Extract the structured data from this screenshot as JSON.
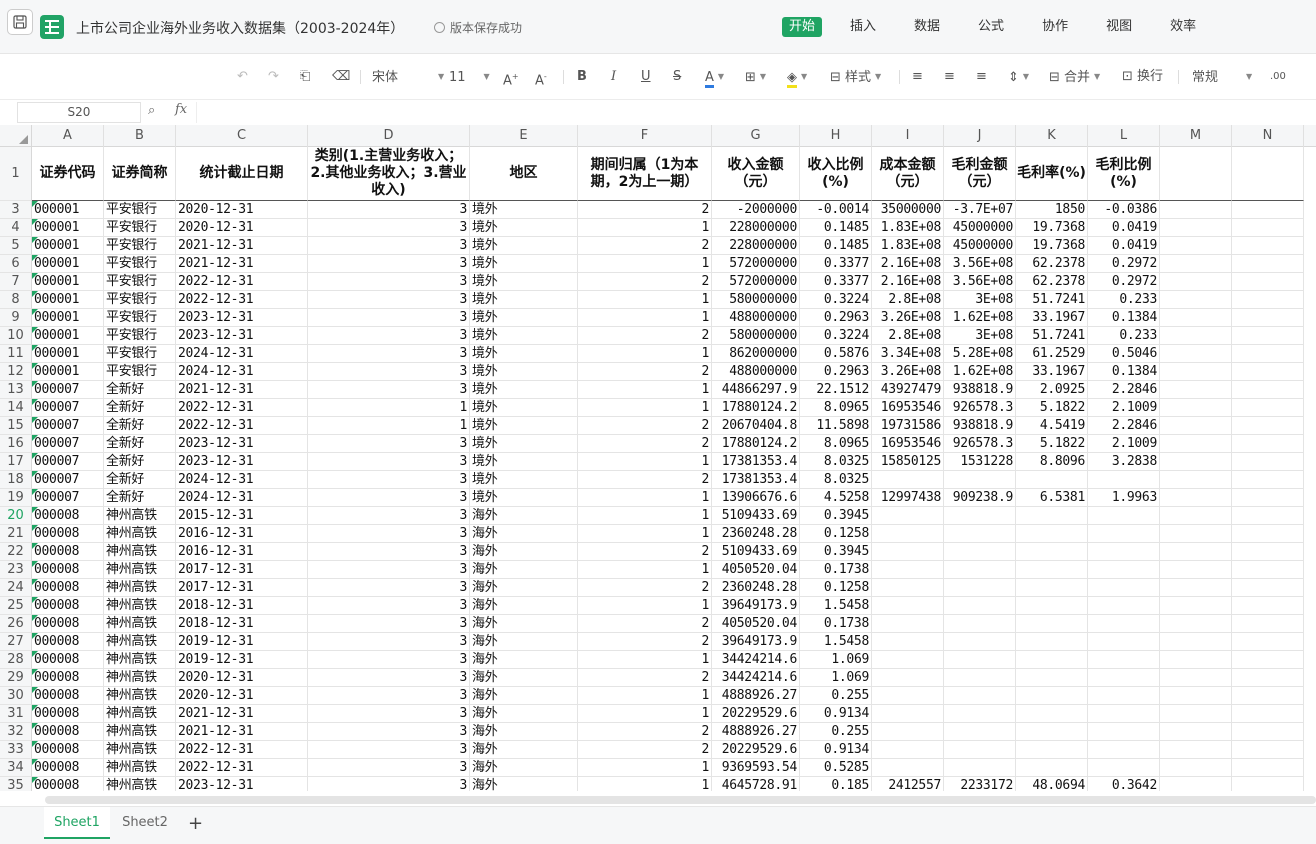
{
  "title_bar": {
    "doc_title": "上市公司企业海外业务收入数据集（2003-2024年）",
    "save_status": "版本保存成功",
    "menu": [
      "开始",
      "插入",
      "数据",
      "公式",
      "协作",
      "视图",
      "效率"
    ],
    "active_menu": "开始"
  },
  "toolbar": {
    "font_name": "宋体",
    "font_size": "11",
    "style_label": "样式",
    "merge_label": "合并",
    "wrap_label": "换行",
    "number_format": "常规"
  },
  "formula_bar": {
    "cell_ref": "S20",
    "fx_label": "fx",
    "value": ""
  },
  "columns": [
    "A",
    "B",
    "C",
    "D",
    "E",
    "F",
    "G",
    "H",
    "I",
    "J",
    "K",
    "L",
    "M",
    "N"
  ],
  "header_row": {
    "row_number": "1",
    "cells": [
      "证券代码",
      "证券简称",
      "统计截止日期",
      "类别(1.主营业务收入；2.其他业务收入；3.营业收入)",
      "地区",
      "期间归属（1为本期，2为上一期）",
      "收入金额（元）",
      "收入比例(%)",
      "成本金额（元）",
      "毛利金额（元）",
      "毛利率(%)",
      "毛利比例(%)"
    ]
  },
  "rows": [
    {
      "n": "3",
      "v": [
        "000001",
        "平安银行",
        "2020-12-31",
        "3",
        "境外",
        "2",
        "-2000000",
        "-0.0014",
        "35000000",
        "-3.7E+07",
        "1850",
        "-0.0386"
      ]
    },
    {
      "n": "4",
      "v": [
        "000001",
        "平安银行",
        "2020-12-31",
        "3",
        "境外",
        "1",
        "228000000",
        "0.1485",
        "1.83E+08",
        "45000000",
        "19.7368",
        "0.0419"
      ]
    },
    {
      "n": "5",
      "v": [
        "000001",
        "平安银行",
        "2021-12-31",
        "3",
        "境外",
        "2",
        "228000000",
        "0.1485",
        "1.83E+08",
        "45000000",
        "19.7368",
        "0.0419"
      ]
    },
    {
      "n": "6",
      "v": [
        "000001",
        "平安银行",
        "2021-12-31",
        "3",
        "境外",
        "1",
        "572000000",
        "0.3377",
        "2.16E+08",
        "3.56E+08",
        "62.2378",
        "0.2972"
      ]
    },
    {
      "n": "7",
      "v": [
        "000001",
        "平安银行",
        "2022-12-31",
        "3",
        "境外",
        "2",
        "572000000",
        "0.3377",
        "2.16E+08",
        "3.56E+08",
        "62.2378",
        "0.2972"
      ]
    },
    {
      "n": "8",
      "v": [
        "000001",
        "平安银行",
        "2022-12-31",
        "3",
        "境外",
        "1",
        "580000000",
        "0.3224",
        "2.8E+08",
        "3E+08",
        "51.7241",
        "0.233"
      ]
    },
    {
      "n": "9",
      "v": [
        "000001",
        "平安银行",
        "2023-12-31",
        "3",
        "境外",
        "1",
        "488000000",
        "0.2963",
        "3.26E+08",
        "1.62E+08",
        "33.1967",
        "0.1384"
      ]
    },
    {
      "n": "10",
      "v": [
        "000001",
        "平安银行",
        "2023-12-31",
        "3",
        "境外",
        "2",
        "580000000",
        "0.3224",
        "2.8E+08",
        "3E+08",
        "51.7241",
        "0.233"
      ]
    },
    {
      "n": "11",
      "v": [
        "000001",
        "平安银行",
        "2024-12-31",
        "3",
        "境外",
        "1",
        "862000000",
        "0.5876",
        "3.34E+08",
        "5.28E+08",
        "61.2529",
        "0.5046"
      ]
    },
    {
      "n": "12",
      "v": [
        "000001",
        "平安银行",
        "2024-12-31",
        "3",
        "境外",
        "2",
        "488000000",
        "0.2963",
        "3.26E+08",
        "1.62E+08",
        "33.1967",
        "0.1384"
      ]
    },
    {
      "n": "13",
      "v": [
        "000007",
        "全新好",
        "2021-12-31",
        "3",
        "境外",
        "1",
        "44866297.9",
        "22.1512",
        "43927479",
        "938818.9",
        "2.0925",
        "2.2846"
      ]
    },
    {
      "n": "14",
      "v": [
        "000007",
        "全新好",
        "2022-12-31",
        "1",
        "境外",
        "1",
        "17880124.2",
        "8.0965",
        "16953546",
        "926578.3",
        "5.1822",
        "2.1009"
      ]
    },
    {
      "n": "15",
      "v": [
        "000007",
        "全新好",
        "2022-12-31",
        "1",
        "境外",
        "2",
        "20670404.8",
        "11.5898",
        "19731586",
        "938818.9",
        "4.5419",
        "2.2846"
      ]
    },
    {
      "n": "16",
      "v": [
        "000007",
        "全新好",
        "2023-12-31",
        "3",
        "境外",
        "2",
        "17880124.2",
        "8.0965",
        "16953546",
        "926578.3",
        "5.1822",
        "2.1009"
      ]
    },
    {
      "n": "17",
      "v": [
        "000007",
        "全新好",
        "2023-12-31",
        "3",
        "境外",
        "1",
        "17381353.4",
        "8.0325",
        "15850125",
        "1531228",
        "8.8096",
        "3.2838"
      ]
    },
    {
      "n": "18",
      "v": [
        "000007",
        "全新好",
        "2024-12-31",
        "3",
        "境外",
        "2",
        "17381353.4",
        "8.0325",
        "",
        "",
        "",
        ""
      ]
    },
    {
      "n": "19",
      "v": [
        "000007",
        "全新好",
        "2024-12-31",
        "3",
        "境外",
        "1",
        "13906676.6",
        "4.5258",
        "12997438",
        "909238.9",
        "6.5381",
        "1.9963"
      ]
    },
    {
      "n": "20",
      "v": [
        "000008",
        "神州高铁",
        "2015-12-31",
        "3",
        "海外",
        "1",
        "5109433.69",
        "0.3945",
        "",
        "",
        "",
        ""
      ]
    },
    {
      "n": "21",
      "v": [
        "000008",
        "神州高铁",
        "2016-12-31",
        "3",
        "海外",
        "1",
        "2360248.28",
        "0.1258",
        "",
        "",
        "",
        ""
      ]
    },
    {
      "n": "22",
      "v": [
        "000008",
        "神州高铁",
        "2016-12-31",
        "3",
        "海外",
        "2",
        "5109433.69",
        "0.3945",
        "",
        "",
        "",
        ""
      ]
    },
    {
      "n": "23",
      "v": [
        "000008",
        "神州高铁",
        "2017-12-31",
        "3",
        "海外",
        "1",
        "4050520.04",
        "0.1738",
        "",
        "",
        "",
        ""
      ]
    },
    {
      "n": "24",
      "v": [
        "000008",
        "神州高铁",
        "2017-12-31",
        "3",
        "海外",
        "2",
        "2360248.28",
        "0.1258",
        "",
        "",
        "",
        ""
      ]
    },
    {
      "n": "25",
      "v": [
        "000008",
        "神州高铁",
        "2018-12-31",
        "3",
        "海外",
        "1",
        "39649173.9",
        "1.5458",
        "",
        "",
        "",
        ""
      ]
    },
    {
      "n": "26",
      "v": [
        "000008",
        "神州高铁",
        "2018-12-31",
        "3",
        "海外",
        "2",
        "4050520.04",
        "0.1738",
        "",
        "",
        "",
        ""
      ]
    },
    {
      "n": "27",
      "v": [
        "000008",
        "神州高铁",
        "2019-12-31",
        "3",
        "海外",
        "2",
        "39649173.9",
        "1.5458",
        "",
        "",
        "",
        ""
      ]
    },
    {
      "n": "28",
      "v": [
        "000008",
        "神州高铁",
        "2019-12-31",
        "3",
        "海外",
        "1",
        "34424214.6",
        "1.069",
        "",
        "",
        "",
        ""
      ]
    },
    {
      "n": "29",
      "v": [
        "000008",
        "神州高铁",
        "2020-12-31",
        "3",
        "海外",
        "2",
        "34424214.6",
        "1.069",
        "",
        "",
        "",
        ""
      ]
    },
    {
      "n": "30",
      "v": [
        "000008",
        "神州高铁",
        "2020-12-31",
        "3",
        "海外",
        "1",
        "4888926.27",
        "0.255",
        "",
        "",
        "",
        ""
      ]
    },
    {
      "n": "31",
      "v": [
        "000008",
        "神州高铁",
        "2021-12-31",
        "3",
        "海外",
        "1",
        "20229529.6",
        "0.9134",
        "",
        "",
        "",
        ""
      ]
    },
    {
      "n": "32",
      "v": [
        "000008",
        "神州高铁",
        "2021-12-31",
        "3",
        "海外",
        "2",
        "4888926.27",
        "0.255",
        "",
        "",
        "",
        ""
      ]
    },
    {
      "n": "33",
      "v": [
        "000008",
        "神州高铁",
        "2022-12-31",
        "3",
        "海外",
        "2",
        "20229529.6",
        "0.9134",
        "",
        "",
        "",
        ""
      ]
    },
    {
      "n": "34",
      "v": [
        "000008",
        "神州高铁",
        "2022-12-31",
        "3",
        "海外",
        "1",
        "9369593.54",
        "0.5285",
        "",
        "",
        "",
        ""
      ]
    },
    {
      "n": "35",
      "v": [
        "000008",
        "神州高铁",
        "2023-12-31",
        "3",
        "海外",
        "1",
        "4645728.91",
        "0.185",
        "2412557",
        "2233172",
        "48.0694",
        "0.3642"
      ]
    }
  ],
  "selected_row": "20",
  "sheets": [
    "Sheet1",
    "Sheet2"
  ],
  "active_sheet": "Sheet1",
  "accent_color": "#1fa463"
}
